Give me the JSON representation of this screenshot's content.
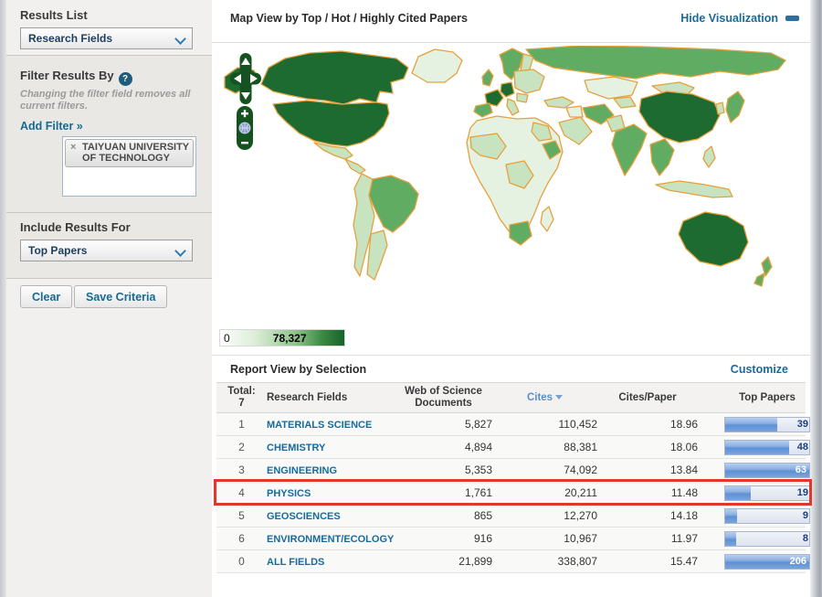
{
  "sidebar": {
    "results_list": {
      "heading": "Results List",
      "dropdown_value": "Research Fields"
    },
    "filter": {
      "heading": "Filter Results By",
      "help_icon": "?",
      "note": "Changing the filter field removes all current filters.",
      "add_filter_label": "Add Filter »",
      "active_filter": {
        "remove_icon": "×",
        "label": "TAIYUAN UNIVERSITY OF TECHNOLOGY"
      }
    },
    "include_results": {
      "heading": "Include Results For",
      "dropdown_value": "Top Papers"
    },
    "actions": {
      "clear_label": "Clear",
      "save_label": "Save Criteria"
    }
  },
  "map_section": {
    "title": "Map View by Top / Hot / Highly Cited Papers",
    "hide_link": "Hide Visualization",
    "legend": {
      "min": "0",
      "max": "78,327"
    },
    "palette": {
      "vlight": "#E6F2E1",
      "light": "#C8E3C0",
      "med": "#61AC63",
      "dark": "#1D6B30",
      "border": "#E5A13D"
    }
  },
  "report": {
    "title": "Report View by Selection",
    "customize_label": "Customize",
    "table": {
      "total_label": "Total:",
      "total_value": "7",
      "col_field": "Research Fields",
      "col_docs": "Web of Science Documents",
      "col_cites": "Cites",
      "col_cpp": "Cites/Paper",
      "col_top": "Top Papers",
      "rows": [
        {
          "rank": "1",
          "field": "MATERIALS SCIENCE",
          "docs": "5,827",
          "cites": "110,452",
          "cpp": "18.96",
          "top": "39",
          "pct": 62,
          "hl": false
        },
        {
          "rank": "2",
          "field": "CHEMISTRY",
          "docs": "4,894",
          "cites": "88,381",
          "cpp": "18.06",
          "top": "48",
          "pct": 76,
          "hl": false
        },
        {
          "rank": "3",
          "field": "ENGINEERING",
          "docs": "5,353",
          "cites": "74,092",
          "cpp": "13.84",
          "top": "63",
          "pct": 100,
          "hl": false
        },
        {
          "rank": "4",
          "field": "PHYSICS",
          "docs": "1,761",
          "cites": "20,211",
          "cpp": "11.48",
          "top": "19",
          "pct": 30,
          "hl": true
        },
        {
          "rank": "5",
          "field": "GEOSCIENCES",
          "docs": "865",
          "cites": "12,270",
          "cpp": "14.18",
          "top": "9",
          "pct": 14,
          "hl": false
        },
        {
          "rank": "6",
          "field": "ENVIRONMENT/ECOLOGY",
          "docs": "916",
          "cites": "10,967",
          "cpp": "11.97",
          "top": "8",
          "pct": 13,
          "hl": false
        },
        {
          "rank": "0",
          "field": "ALL FIELDS",
          "docs": "21,899",
          "cites": "338,807",
          "cpp": "15.47",
          "top": "206",
          "pct": 100,
          "hl": false
        }
      ]
    }
  }
}
